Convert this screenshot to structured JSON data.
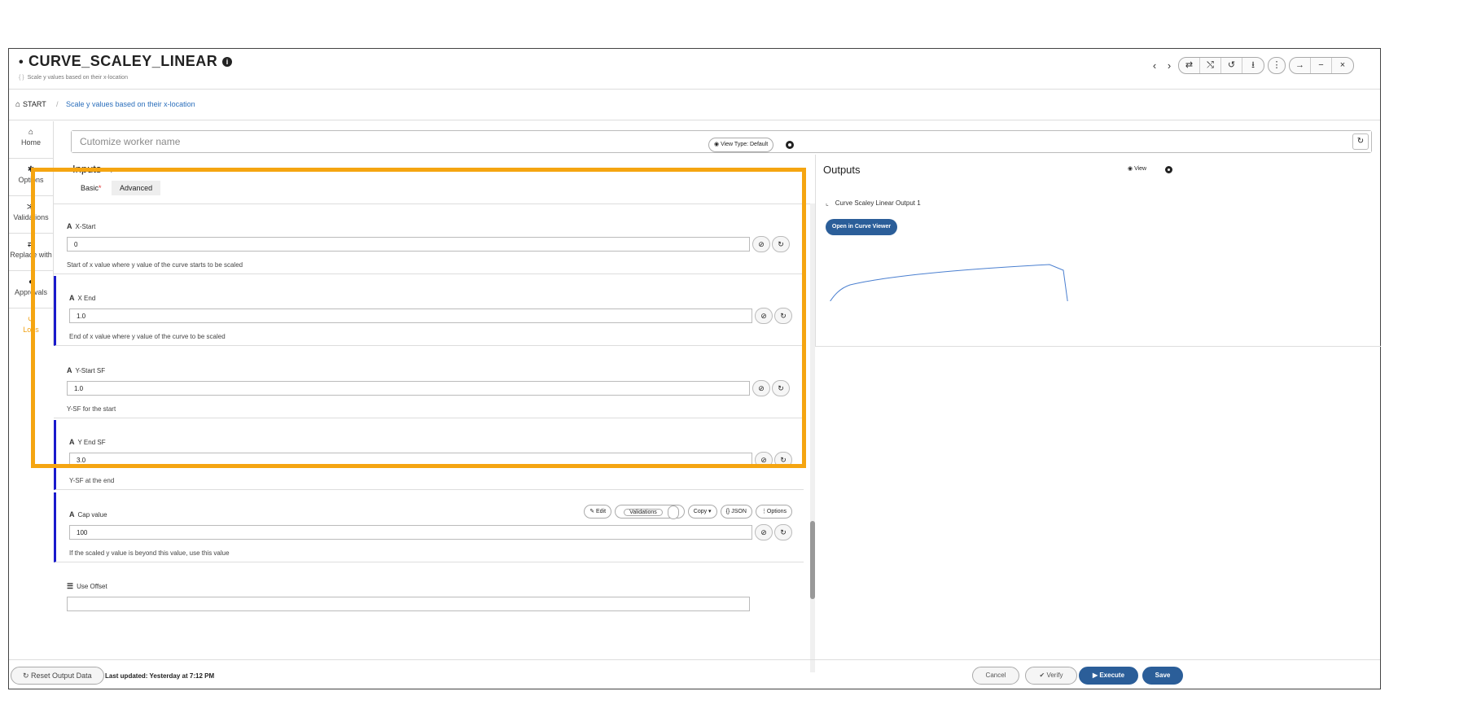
{
  "window": {
    "title": "CURVE_SCALEY_LINEAR",
    "subtitle": "Scale y values based on their x-location",
    "subtitle_icon": "{ }",
    "toolbar_nav": [
      "‹",
      "›"
    ],
    "toolbar_group1": [
      "⇄",
      "⤭",
      "↺",
      "⭳"
    ],
    "toolbar_menu": "⋮",
    "toolbar_group2": [
      "→",
      "−",
      "×"
    ]
  },
  "breadcrumb": {
    "home": "START",
    "sep": "/",
    "current": "Scale y values based on their x-location"
  },
  "sidebar": {
    "items": [
      {
        "label": "Home",
        "icon": "home-icon",
        "glyph": "⌂"
      },
      {
        "label": "Options",
        "icon": "gear-icon",
        "glyph": "✱"
      },
      {
        "label": "Validations",
        "icon": "check-double-icon",
        "glyph": "≫"
      },
      {
        "label": "Replace with",
        "icon": "swap-icon",
        "glyph": "⇄"
      },
      {
        "label": "Approvals",
        "icon": "user-icon",
        "glyph": "●"
      },
      {
        "label": "Logs",
        "icon": "history-icon",
        "glyph": "↺"
      }
    ]
  },
  "worker_name": {
    "placeholder": "Cutomize worker name",
    "refresh_glyph": "↻"
  },
  "inputs": {
    "heading": "Inputs",
    "view_type": "View Type: Default",
    "tabs": [
      {
        "label": "Basic",
        "required": "*"
      },
      {
        "label": "Advanced"
      }
    ],
    "fields": [
      {
        "label": "X-Start",
        "type_glyph": "A",
        "value": "0",
        "desc": "Start of x value where y value of the curve starts to be scaled"
      },
      {
        "label": "X End",
        "type_glyph": "A",
        "value": "1.0",
        "desc": "End of x value where y value of the curve to be scaled"
      },
      {
        "label": "Y-Start SF",
        "type_glyph": "A",
        "value": "1.0",
        "desc": "Y-SF for the start"
      },
      {
        "label": "Y End SF",
        "type_glyph": "A",
        "value": "3.0",
        "desc": "Y-SF at the end"
      },
      {
        "label": "Cap value",
        "type_glyph": "A",
        "value": "100",
        "desc": "If the scaled y value is beyond this value, use this value"
      },
      {
        "label": "Use Offset",
        "type_glyph": "☰",
        "value": "",
        "desc": ""
      }
    ],
    "field_tools": {
      "edit": "✎ Edit",
      "validations": "Validations",
      "validations_count": "0",
      "copy": "Copy ▾",
      "json": "{} JSON",
      "options": "⋮Options"
    },
    "attach_glyph": "⊘",
    "refresh_glyph": "↻"
  },
  "outputs": {
    "heading": "Outputs",
    "view": "View",
    "item": "Curve Scaley Linear Output 1",
    "open_button": "Open in Curve Viewer"
  },
  "footer": {
    "reset": "↻ Reset Output Data",
    "updated": "Last updated: Yesterday at 7:12 PM",
    "cancel": "Cancel",
    "verify": "✔ Verify",
    "execute": "▶ Execute",
    "save": "Save"
  },
  "colors": {
    "accent": "#2b5e99",
    "highlight": "#f5a511",
    "active_side": "#f0a010"
  }
}
